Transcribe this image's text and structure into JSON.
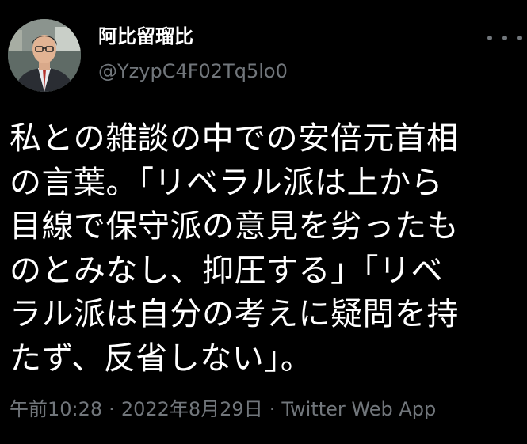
{
  "author": {
    "display_name": "阿比留瑠比",
    "handle": "@YzypC4F02Tq5lo0",
    "avatar_icon": "user-portrait-icon"
  },
  "menu": {
    "more_icon": "more-options-icon"
  },
  "tweet": {
    "text": "私との雑談の中での安倍元首相\nの言葉。「リベラル派は上から\n目線で保守派の意見を劣ったも\nのとみなし、抑圧する」「リベ\nラル派は自分の考えに疑問を持\nたず、反省しない」。"
  },
  "meta": {
    "time": "午前10:28",
    "separator": "·",
    "date": "2022年8月29日",
    "source": "Twitter Web App"
  },
  "colors": {
    "background": "#000000",
    "primary_text": "#ffffff",
    "secondary_text": "#71767b"
  }
}
